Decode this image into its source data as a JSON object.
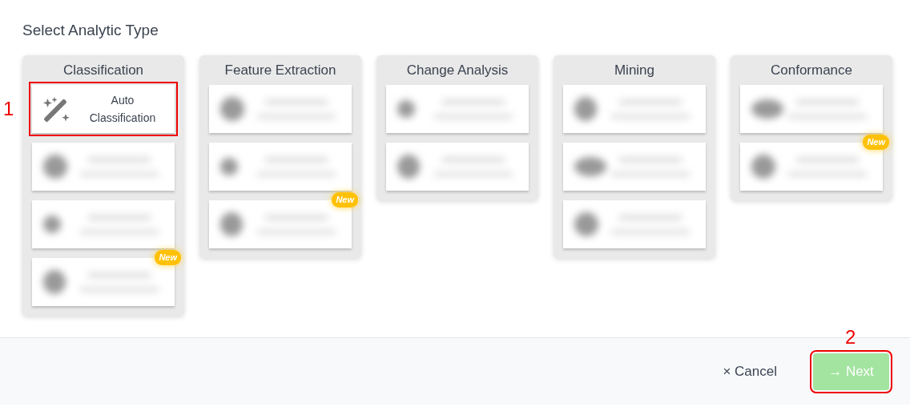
{
  "title": "Select Analytic Type",
  "groups": [
    {
      "title": "Classification",
      "items": [
        {
          "kind": "option",
          "label": "Auto Classification",
          "callout": "1"
        },
        {
          "kind": "blurred"
        },
        {
          "kind": "blurred"
        },
        {
          "kind": "blurred",
          "badge": "New"
        }
      ]
    },
    {
      "title": "Feature Extraction",
      "items": [
        {
          "kind": "blurred"
        },
        {
          "kind": "blurred"
        },
        {
          "kind": "blurred",
          "badge": "New"
        }
      ]
    },
    {
      "title": "Change Analysis",
      "items": [
        {
          "kind": "blurred"
        },
        {
          "kind": "blurred"
        }
      ]
    },
    {
      "title": "Mining",
      "items": [
        {
          "kind": "blurred"
        },
        {
          "kind": "blurred"
        },
        {
          "kind": "blurred"
        }
      ]
    },
    {
      "title": "Conformance",
      "items": [
        {
          "kind": "blurred"
        },
        {
          "kind": "blurred",
          "badge": "New"
        }
      ]
    }
  ],
  "footer": {
    "cancel": {
      "icon": "×",
      "label": "Cancel"
    },
    "next": {
      "icon": "→",
      "label": "Next",
      "disabled": true,
      "callout": "2"
    }
  }
}
